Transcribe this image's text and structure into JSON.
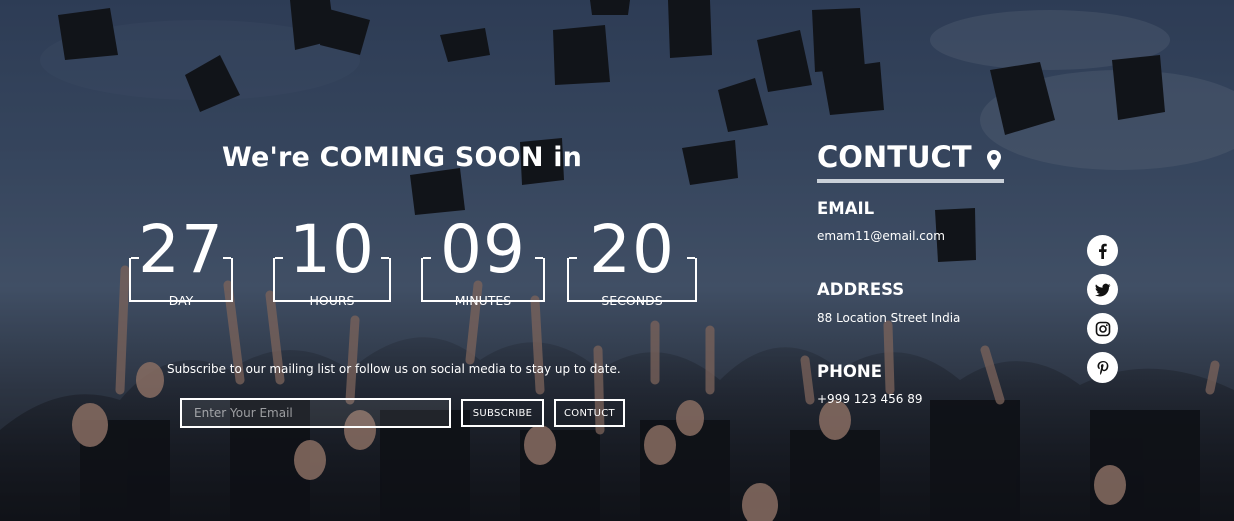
{
  "hero": {
    "heading": "We're COMING SOON in"
  },
  "countdown": [
    {
      "value": "27",
      "label": "DAY"
    },
    {
      "value": "10",
      "label": "HOURS"
    },
    {
      "value": "09",
      "label": "MINUTES"
    },
    {
      "value": "20",
      "label": "SECONDS"
    }
  ],
  "subscribe": {
    "text": "Subscribe to our mailing list or follow us on social media to stay up to date.",
    "email_placeholder": "Enter Your Email",
    "subscribe_label": "SUBSCRIBE",
    "contact_label": "CONTUCT"
  },
  "contact": {
    "title": "CONTUCT",
    "icon": "map-pin-icon",
    "email_label": "EMAIL",
    "email_value": "emam11@email.com",
    "address_label": "ADDRESS",
    "address_value": "88 Location Street India",
    "phone_label": "PHONE",
    "phone_value": "+999 123 456 89"
  },
  "social": [
    {
      "icon": "facebook-icon"
    },
    {
      "icon": "twitter-icon"
    },
    {
      "icon": "instagram-icon"
    },
    {
      "icon": "pinterest-icon"
    }
  ],
  "colors": {
    "text": "#ffffff",
    "underline": "#c9d0d8",
    "social_bg": "#ffffff"
  }
}
